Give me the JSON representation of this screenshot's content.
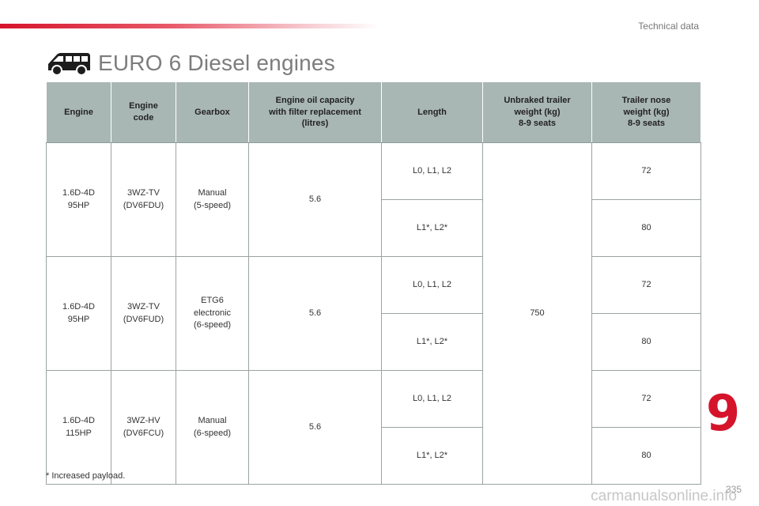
{
  "header": {
    "section_label": "Technical data"
  },
  "title": {
    "icon": "van-icon",
    "text": "EURO 6 Diesel engines"
  },
  "table": {
    "headers": [
      "Engine",
      "Engine\ncode",
      "Gearbox",
      "Engine oil capacity\nwith filter replacement\n(litres)",
      "Length",
      "Unbraked trailer\nweight (kg)\n8-9 seats",
      "Trailer nose\nweight (kg)\n8-9 seats"
    ],
    "engines": [
      {
        "engine": "1.6D-4D\n95HP",
        "code": "3WZ-TV\n(DV6FDU)",
        "gearbox": "Manual\n(5-speed)",
        "oil": "5.6",
        "lengths": [
          {
            "length": "L0, L1, L2",
            "nose": "72"
          },
          {
            "length": "L1*, L2*",
            "nose": "80"
          }
        ]
      },
      {
        "engine": "1.6D-4D\n95HP",
        "code": "3WZ-TV\n(DV6FUD)",
        "gearbox": "ETG6\nelectronic\n(6-speed)",
        "oil": "5.6",
        "lengths": [
          {
            "length": "L0, L1, L2",
            "nose": "72"
          },
          {
            "length": "L1*, L2*",
            "nose": "80"
          }
        ]
      },
      {
        "engine": "1.6D-4D\n115HP",
        "code": "3WZ-HV\n(DV6FCU)",
        "gearbox": "Manual\n(6-speed)",
        "oil": "5.6",
        "lengths": [
          {
            "length": "L0, L1, L2",
            "nose": "72"
          },
          {
            "length": "L1*, L2*",
            "nose": "80"
          }
        ]
      }
    ],
    "unbraked_trailer_weight": "750"
  },
  "footnote": "* Increased payload.",
  "chapter_number": "9",
  "page_number": "335",
  "watermark": "carmanualsonline.info",
  "colors": {
    "accent": "#d5142b",
    "header_bg": "#a9b7b4"
  }
}
